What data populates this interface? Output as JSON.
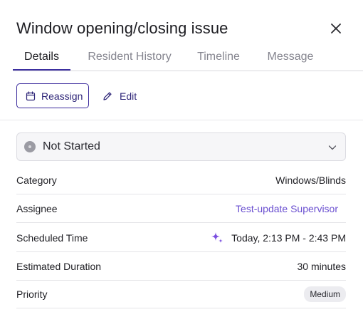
{
  "header": {
    "title": "Window opening/closing issue"
  },
  "tabs": [
    {
      "label": "Details",
      "active": true
    },
    {
      "label": "Resident History",
      "active": false
    },
    {
      "label": "Timeline",
      "active": false
    },
    {
      "label": "Message",
      "active": false
    }
  ],
  "actions": {
    "reassign_label": "Reassign",
    "edit_label": "Edit"
  },
  "status": {
    "selected": "Not Started"
  },
  "details": {
    "category": {
      "label": "Category",
      "value": "Windows/Blinds"
    },
    "assignee": {
      "label": "Assignee",
      "value": "Test-update Supervisor"
    },
    "scheduled": {
      "label": "Scheduled Time",
      "value": "Today, 2:13 PM - 2:43 PM"
    },
    "duration": {
      "label": "Estimated Duration",
      "value": "30 minutes"
    },
    "priority": {
      "label": "Priority",
      "value": "Medium"
    }
  },
  "colors": {
    "accent": "#3a2a9c",
    "link": "#6a4fd0",
    "sparkle": "#7b4fe0"
  }
}
